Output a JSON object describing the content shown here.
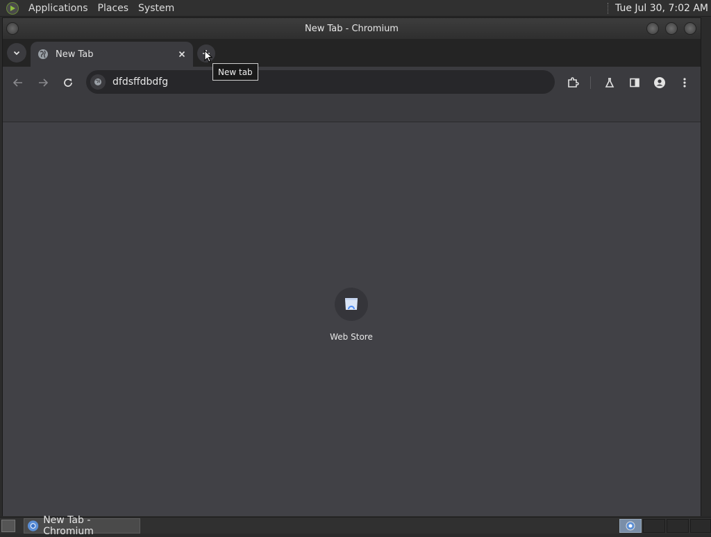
{
  "top_panel": {
    "menus": [
      "Applications",
      "Places",
      "System"
    ],
    "clock": "Tue Jul 30,  7:02 AM"
  },
  "window": {
    "title": "New Tab - Chromium"
  },
  "tabs": [
    {
      "title": "New Tab",
      "icon": "globe-icon"
    }
  ],
  "tooltip": {
    "text": "New tab"
  },
  "omnibox": {
    "value": "dfdsffdbdfg"
  },
  "shortcuts": [
    {
      "label": "Web Store",
      "icon": "web-store-icon"
    }
  ],
  "taskbar": {
    "task_label": "New Tab - Chromium"
  },
  "colors": {
    "panel": "#303030",
    "toolbar": "#3b3b3f",
    "content": "#414146",
    "accent_blue": "#4c8df6"
  }
}
